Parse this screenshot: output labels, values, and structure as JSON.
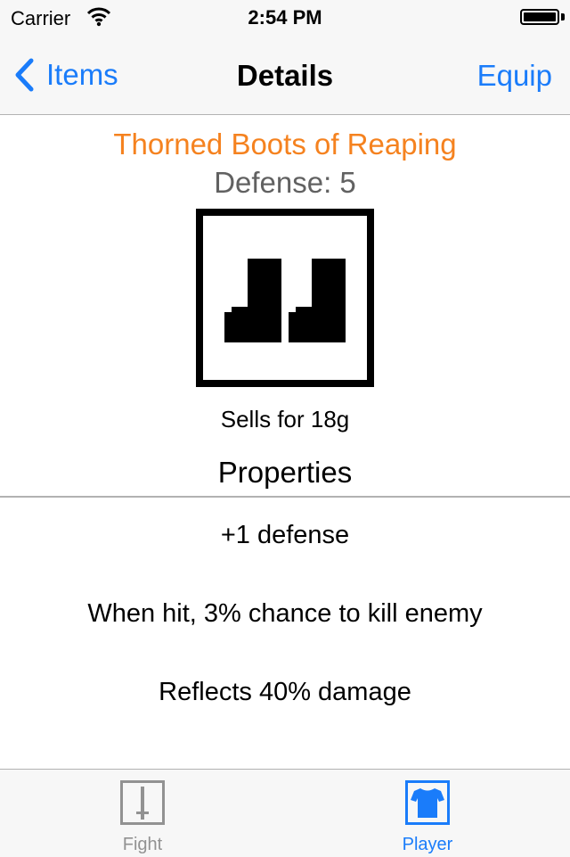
{
  "status_bar": {
    "carrier": "Carrier",
    "time": "2:54 PM"
  },
  "nav": {
    "back_label": "Items",
    "title": "Details",
    "action_label": "Equip"
  },
  "item": {
    "name": "Thorned Boots of Reaping",
    "defense_text": "Defense: 5",
    "icon": "boots-icon",
    "sell_text": "Sells for 18g"
  },
  "properties": {
    "heading": "Properties",
    "items": [
      "+1 defense",
      "When hit, 3% chance to kill enemy",
      "Reflects 40% damage"
    ]
  },
  "tabs": [
    {
      "label": "Fight",
      "icon": "sword-icon",
      "selected": false
    },
    {
      "label": "Player",
      "icon": "shirt-icon",
      "selected": true
    }
  ],
  "colors": {
    "accent": "#1a7cfa",
    "item_name": "#f5821f",
    "secondary_text": "#616161",
    "tab_inactive": "#929292"
  }
}
